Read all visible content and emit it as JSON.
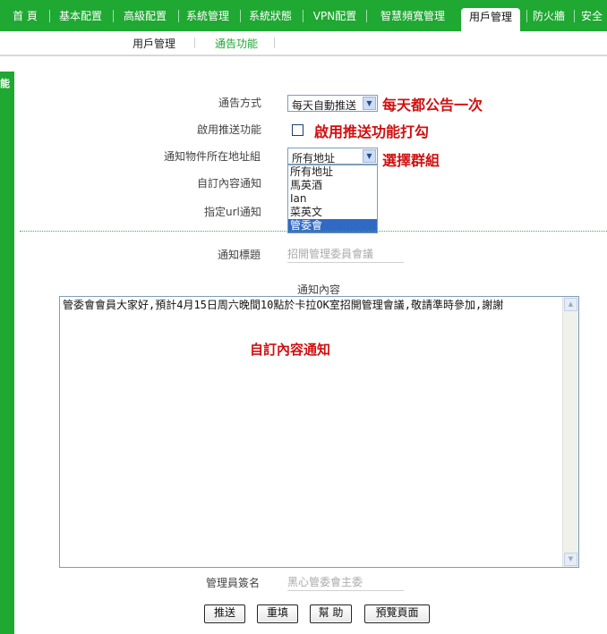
{
  "nav": {
    "tabs": [
      "首 頁",
      "基本配置",
      "高級配置",
      "系統管理",
      "系統狀態",
      "VPN配置",
      "智慧頻寬管理",
      "用戶管理",
      "防火牆",
      "安全"
    ],
    "active": "用戶管理"
  },
  "subnav": {
    "items": [
      "用戶管理",
      "通告功能"
    ],
    "active": "通告功能"
  },
  "left_strip": {
    "text": "能"
  },
  "form": {
    "notify_method": {
      "label": "通告方式",
      "value": "每天自動推送",
      "annotation": "每天都公告一次"
    },
    "enable_push": {
      "label": "啟用推送功能",
      "checked": false,
      "annotation": "啟用推送功能打勾"
    },
    "address_group": {
      "label": "通知物件所在地址組",
      "value": "所有地址",
      "annotation": "選擇群組",
      "options": [
        "所有地址",
        "馬英酒",
        "Ian",
        "菜英文",
        "管委會"
      ],
      "highlighted": "管委會"
    },
    "custom_notice": {
      "label": "自訂內容通知"
    },
    "url_notice": {
      "label": "指定url通知"
    },
    "title": {
      "label": "通知標題",
      "placeholder": "招開管理委員會議"
    },
    "content": {
      "label": "通知內容",
      "value": "管委會會員大家好,預計4月15日周六晚間10點於卡拉OK室招開管理會議,敬請準時參加,謝謝",
      "annotation": "自訂內容通知"
    },
    "signature": {
      "label": "管理員簽名",
      "placeholder": "黑心管委會主委"
    }
  },
  "buttons": {
    "push": "推送",
    "reset": "重填",
    "help": "幫 助",
    "preview": "預覽頁面"
  },
  "colors": {
    "nav_green": "#1fa832",
    "annotation_red": "#d01010",
    "select_blue": "#316ac5"
  }
}
